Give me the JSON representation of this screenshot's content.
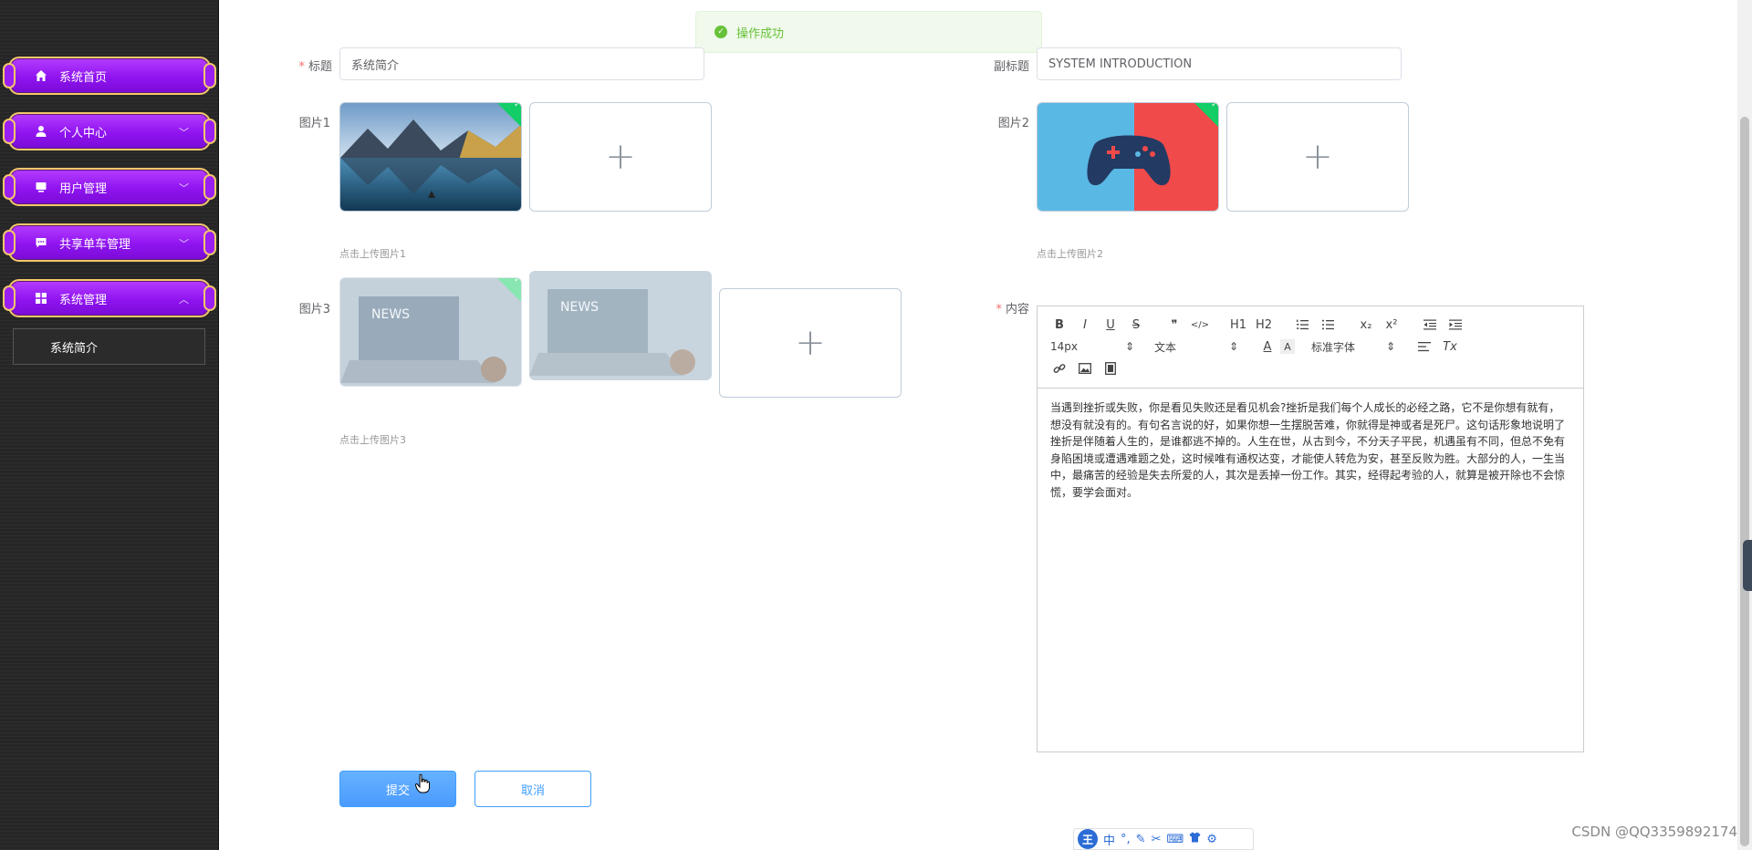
{
  "sidebar": {
    "items": [
      {
        "label": "系统首页",
        "icon": "home-icon",
        "chevron": ""
      },
      {
        "label": "个人中心",
        "icon": "user-icon",
        "chevron": "﹀"
      },
      {
        "label": "用户管理",
        "icon": "monitor-icon",
        "chevron": "﹀"
      },
      {
        "label": "共享单车管理",
        "icon": "message-icon",
        "chevron": "﹀"
      },
      {
        "label": "系统管理",
        "icon": "grid-icon",
        "chevron": "︿"
      }
    ],
    "submenu": {
      "label": "系统简介"
    }
  },
  "toast": {
    "text": "操作成功"
  },
  "form": {
    "title_label": "标题",
    "title_value": "系统简介",
    "subtitle_label": "副标题",
    "subtitle_value": "SYSTEM INTRODUCTION",
    "pic1_label": "图片1",
    "pic1_tip": "点击上传图片1",
    "pic2_label": "图片2",
    "pic2_tip": "点击上传图片2",
    "pic3_label": "图片3",
    "pic3_tip": "点击上传图片3",
    "content_label": "内容",
    "upload_plus": "+"
  },
  "editor": {
    "toolbar": {
      "bold": "B",
      "italic": "I",
      "underline": "U",
      "strike": "S",
      "quote": "❞",
      "code": "</>",
      "h1": "H1",
      "h2": "H2",
      "subscript": "x₂",
      "superscript": "x²",
      "size": "14px",
      "header": "文本",
      "font": "标准字体",
      "clean": "Tx"
    },
    "content": "当遇到挫折或失败，你是看见失败还是看见机会?挫折是我们每个人成长的必经之路，它不是你想有就有，想没有就没有的。有句名言说的好，如果你想一生摆脱苦难，你就得是神或者是死尸。这句话形象地说明了挫折是伴随着人生的，是谁都逃不掉的。人生在世，从古到今，不分天子平民，机遇虽有不同，但总不免有身陷困境或遭遇难题之处，这时候唯有通权达变，才能使人转危为安，甚至反败为胜。大部分的人，一生当中，最痛苦的经验是失去所爱的人，其次是丢掉一份工作。其实，经得起考验的人，就算是被开除也不会惊慌，要学会面对。"
  },
  "buttons": {
    "submit": "提交",
    "cancel": "取消"
  },
  "ime": {
    "wang": "王",
    "zh": "中",
    "punct": "°,"
  },
  "watermark": "CSDN @QQ3359892174",
  "colors": {
    "menu_purple": "#9a1ff3",
    "menu_border": "#f2c86a",
    "primary": "#409eff",
    "success": "#67c23a",
    "required": "#f56c6c"
  }
}
